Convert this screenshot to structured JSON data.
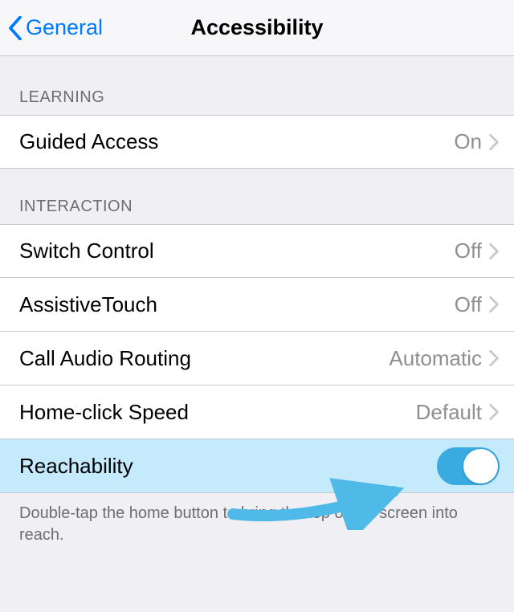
{
  "header": {
    "back_label": "General",
    "title": "Accessibility"
  },
  "sections": {
    "learning": {
      "header": "LEARNING",
      "items": [
        {
          "label": "Guided Access",
          "value": "On"
        }
      ]
    },
    "interaction": {
      "header": "INTERACTION",
      "items": [
        {
          "label": "Switch Control",
          "value": "Off"
        },
        {
          "label": "AssistiveTouch",
          "value": "Off"
        },
        {
          "label": "Call Audio Routing",
          "value": "Automatic"
        },
        {
          "label": "Home-click Speed",
          "value": "Default"
        },
        {
          "label": "Reachability",
          "toggle": true,
          "on": true
        }
      ],
      "footer": "Double-tap the home button to bring the top of the screen into reach."
    }
  }
}
